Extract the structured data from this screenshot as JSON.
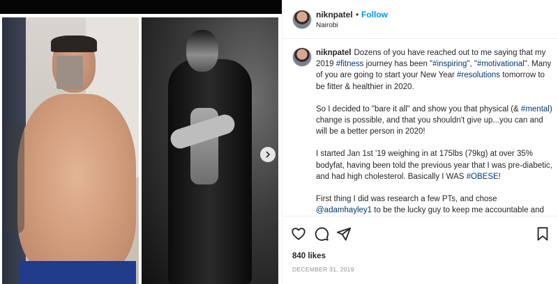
{
  "post": {
    "username": "niknpatel",
    "follow_label": "Follow",
    "separator": "•",
    "location": "Nairobi",
    "caption": {
      "p1_a": "Dozens of you have reached out to me saying that my 2019 ",
      "p1_tag1": "#fitness",
      "p1_b": " journey has been \"",
      "p1_tag2": "#inspiring",
      "p1_c": "\", \"",
      "p1_tag3": "#motivational",
      "p1_d": "\". Many of you are going to start your New Year ",
      "p1_tag4": "#resolutions",
      "p1_e": " tomorrow to be fitter & healthier in 2020.",
      "p2_a": "So I decided to \"bare it all\" and show you that physical (& ",
      "p2_tag": "#mental",
      "p2_b": ") change is possible, and that you shouldn't give up...you can and will be a better person in 2020!",
      "p3_a": "I started Jan 1st '19 weighing in at 175lbs (79kg) at over 35% bodyfat, having been told the previous year that I was pre-diabetic, and had high cholesterol. Basically I WAS ",
      "p3_tag": "#OBESE",
      "p3_b": "!",
      "p4_a": "First thing I did was research a few PTs, and chose ",
      "p4_tag": "@adamhayley1",
      "p4_b": " to be the lucky guy to keep me accountable and be my Mr Miyagi (he is kinda short like him now that I think about it!) through my journey."
    },
    "likes": "840 likes",
    "date": "DECEMBER 31, 2019"
  },
  "icons": {
    "like": "heart-icon",
    "comment": "comment-icon",
    "share": "share-icon",
    "save": "bookmark-icon",
    "next": "chevron-right-icon"
  },
  "colors": {
    "link": "#00376b",
    "follow": "#0095f6",
    "text": "#262626",
    "muted": "#8e8e8e"
  }
}
